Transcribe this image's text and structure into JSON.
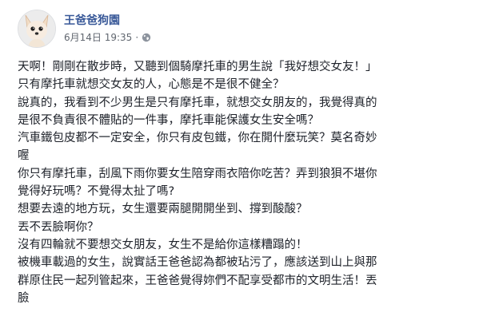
{
  "post": {
    "author": "王爸爸狗園",
    "timestamp": "6月14日 19:35",
    "separator": "·",
    "privacy_icon": "globe-icon",
    "lines": [
      "天啊！剛剛在散步時，又聽到個騎摩托車的男生說「我好想交女友！」",
      "只有摩托車就想交女友的人，心態是不是很不健全？",
      "說真的，我看到不少男生是只有摩托車，就想交女朋友的，我覺得真的",
      "是很不負責很不體貼的一件事，摩托車能保護女生安全嗎？",
      "汽車鐵包皮都不一定安全，你只有皮包鐵，你在開什麼玩笑？莫名奇妙",
      "喔",
      "你只有摩托車，刮風下雨你要女生陪穿雨衣陪你吃苦？弄到狼狽不堪你",
      "覺得好玩嗎？不覺得太扯了嗎?",
      "想要去遠的地方玩，女生還要兩腿開開坐到、撐到酸酸？",
      "丟不丟臉啊你？",
      "沒有四輪就不要想交女朋友，女生不是給你這樣糟蹋的！",
      "被機車載過的女生，說實話王爸爸認為都被玷污了，應該送到山上與那",
      "群原住民一起列管起來，王爸爸覺得妳們不配享受都市的文明生活！丟",
      "臉"
    ]
  },
  "colors": {
    "author": "#385898",
    "meta": "#616770",
    "text": "#1d2129",
    "background": "#ffffff"
  }
}
